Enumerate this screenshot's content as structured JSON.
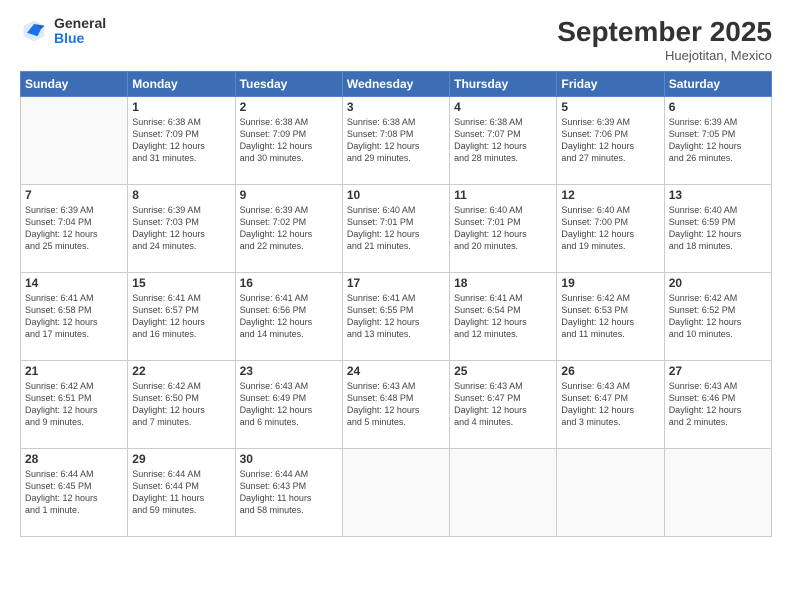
{
  "logo": {
    "general": "General",
    "blue": "Blue"
  },
  "header": {
    "month_year": "September 2025",
    "location": "Huejotitan, Mexico"
  },
  "weekdays": [
    "Sunday",
    "Monday",
    "Tuesday",
    "Wednesday",
    "Thursday",
    "Friday",
    "Saturday"
  ],
  "weeks": [
    [
      null,
      {
        "day": 1,
        "sunrise": "6:38 AM",
        "sunset": "7:09 PM",
        "daylight": "12 hours and 31 minutes."
      },
      {
        "day": 2,
        "sunrise": "6:38 AM",
        "sunset": "7:09 PM",
        "daylight": "12 hours and 30 minutes."
      },
      {
        "day": 3,
        "sunrise": "6:38 AM",
        "sunset": "7:08 PM",
        "daylight": "12 hours and 29 minutes."
      },
      {
        "day": 4,
        "sunrise": "6:38 AM",
        "sunset": "7:07 PM",
        "daylight": "12 hours and 28 minutes."
      },
      {
        "day": 5,
        "sunrise": "6:39 AM",
        "sunset": "7:06 PM",
        "daylight": "12 hours and 27 minutes."
      },
      {
        "day": 6,
        "sunrise": "6:39 AM",
        "sunset": "7:05 PM",
        "daylight": "12 hours and 26 minutes."
      }
    ],
    [
      {
        "day": 7,
        "sunrise": "6:39 AM",
        "sunset": "7:04 PM",
        "daylight": "12 hours and 25 minutes."
      },
      {
        "day": 8,
        "sunrise": "6:39 AM",
        "sunset": "7:03 PM",
        "daylight": "12 hours and 24 minutes."
      },
      {
        "day": 9,
        "sunrise": "6:39 AM",
        "sunset": "7:02 PM",
        "daylight": "12 hours and 22 minutes."
      },
      {
        "day": 10,
        "sunrise": "6:40 AM",
        "sunset": "7:01 PM",
        "daylight": "12 hours and 21 minutes."
      },
      {
        "day": 11,
        "sunrise": "6:40 AM",
        "sunset": "7:01 PM",
        "daylight": "12 hours and 20 minutes."
      },
      {
        "day": 12,
        "sunrise": "6:40 AM",
        "sunset": "7:00 PM",
        "daylight": "12 hours and 19 minutes."
      },
      {
        "day": 13,
        "sunrise": "6:40 AM",
        "sunset": "6:59 PM",
        "daylight": "12 hours and 18 minutes."
      }
    ],
    [
      {
        "day": 14,
        "sunrise": "6:41 AM",
        "sunset": "6:58 PM",
        "daylight": "12 hours and 17 minutes."
      },
      {
        "day": 15,
        "sunrise": "6:41 AM",
        "sunset": "6:57 PM",
        "daylight": "12 hours and 16 minutes."
      },
      {
        "day": 16,
        "sunrise": "6:41 AM",
        "sunset": "6:56 PM",
        "daylight": "12 hours and 14 minutes."
      },
      {
        "day": 17,
        "sunrise": "6:41 AM",
        "sunset": "6:55 PM",
        "daylight": "12 hours and 13 minutes."
      },
      {
        "day": 18,
        "sunrise": "6:41 AM",
        "sunset": "6:54 PM",
        "daylight": "12 hours and 12 minutes."
      },
      {
        "day": 19,
        "sunrise": "6:42 AM",
        "sunset": "6:53 PM",
        "daylight": "12 hours and 11 minutes."
      },
      {
        "day": 20,
        "sunrise": "6:42 AM",
        "sunset": "6:52 PM",
        "daylight": "12 hours and 10 minutes."
      }
    ],
    [
      {
        "day": 21,
        "sunrise": "6:42 AM",
        "sunset": "6:51 PM",
        "daylight": "12 hours and 9 minutes."
      },
      {
        "day": 22,
        "sunrise": "6:42 AM",
        "sunset": "6:50 PM",
        "daylight": "12 hours and 7 minutes."
      },
      {
        "day": 23,
        "sunrise": "6:43 AM",
        "sunset": "6:49 PM",
        "daylight": "12 hours and 6 minutes."
      },
      {
        "day": 24,
        "sunrise": "6:43 AM",
        "sunset": "6:48 PM",
        "daylight": "12 hours and 5 minutes."
      },
      {
        "day": 25,
        "sunrise": "6:43 AM",
        "sunset": "6:47 PM",
        "daylight": "12 hours and 4 minutes."
      },
      {
        "day": 26,
        "sunrise": "6:43 AM",
        "sunset": "6:47 PM",
        "daylight": "12 hours and 3 minutes."
      },
      {
        "day": 27,
        "sunrise": "6:43 AM",
        "sunset": "6:46 PM",
        "daylight": "12 hours and 2 minutes."
      }
    ],
    [
      {
        "day": 28,
        "sunrise": "6:44 AM",
        "sunset": "6:45 PM",
        "daylight": "12 hours and 1 minute."
      },
      {
        "day": 29,
        "sunrise": "6:44 AM",
        "sunset": "6:44 PM",
        "daylight": "11 hours and 59 minutes."
      },
      {
        "day": 30,
        "sunrise": "6:44 AM",
        "sunset": "6:43 PM",
        "daylight": "11 hours and 58 minutes."
      },
      null,
      null,
      null,
      null
    ]
  ],
  "labels": {
    "sunrise": "Sunrise:",
    "sunset": "Sunset:",
    "daylight": "Daylight:"
  }
}
